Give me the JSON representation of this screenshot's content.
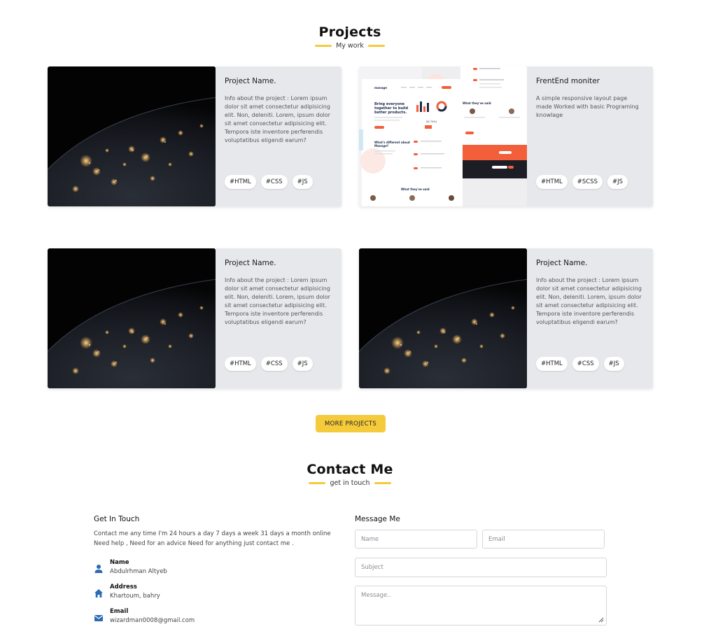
{
  "projects_section": {
    "title": "Projects",
    "subtitle": "My work"
  },
  "projects": [
    {
      "title": "Project Name.",
      "description": "Info about the project : Lorem ipsum dolor sit amet consectetur adipisicing elit. Non, deleniti. Lorem, ipsum dolor sit amet consectetur adipisicing elit. Tempora iste inventore perferendis voluptatibus eligendi earum?",
      "tags": [
        "#HTML",
        "#CSS",
        "#JS"
      ],
      "image": "earth-at-night"
    },
    {
      "title": "FrentEnd moniter",
      "description": "A simple responsive layout page made Worked with basic Programing knowlage",
      "tags": [
        "#HTML",
        "#SCSS",
        "#JS"
      ],
      "image": "website-mockup"
    },
    {
      "title": "Project Name.",
      "description": "Info about the project : Lorem ipsum dolor sit amet consectetur adipisicing elit. Non, deleniti. Lorem, ipsum dolor sit amet consectetur adipisicing elit. Tempora iste inventore perferendis voluptatibus eligendi earum?",
      "tags": [
        "#HTML",
        "#CSS",
        "#JS"
      ],
      "image": "earth-at-night"
    },
    {
      "title": "Project Name.",
      "description": "Info about the project : Lorem ipsum dolor sit amet consectetur adipisicing elit. Non, deleniti. Lorem, ipsum dolor sit amet consectetur adipisicing elit. Tempora iste inventore perferendis voluptatibus eligendi earum?",
      "tags": [
        "#HTML",
        "#CSS",
        "#JS"
      ],
      "image": "earth-at-night"
    }
  ],
  "mockup": {
    "headline": "Bring everyone together to build better products.",
    "stat": "(8/ 74%)",
    "section1": "What's different about Manage?",
    "section2": "What they've said"
  },
  "more_button": "MORE PROJECTS",
  "contact_section": {
    "title": "Contact Me",
    "subtitle": "get in touch"
  },
  "get_in_touch": {
    "title": "Get In Touch",
    "description": "Contact me any time I'm 24 hours a day 7 days a week 31 days a month online Need help , Need for an advice Need for anything just contact me .",
    "items": [
      {
        "label": "Name",
        "value": "Abdulrhman Altyeb",
        "icon": "person-icon"
      },
      {
        "label": "Address",
        "value": "Khartoum, bahry",
        "icon": "home-icon"
      },
      {
        "label": "Email",
        "value": "wizardman0008@gmail.com",
        "icon": "mail-icon"
      }
    ]
  },
  "message_me": {
    "title": "Message Me",
    "name_placeholder": "Name",
    "email_placeholder": "Email",
    "subject_placeholder": "Subject",
    "message_placeholder": "Message.."
  },
  "colors": {
    "accent": "#f5cb3b",
    "card_bg": "#e7e8eb",
    "icon_blue": "#2c6bb3"
  }
}
